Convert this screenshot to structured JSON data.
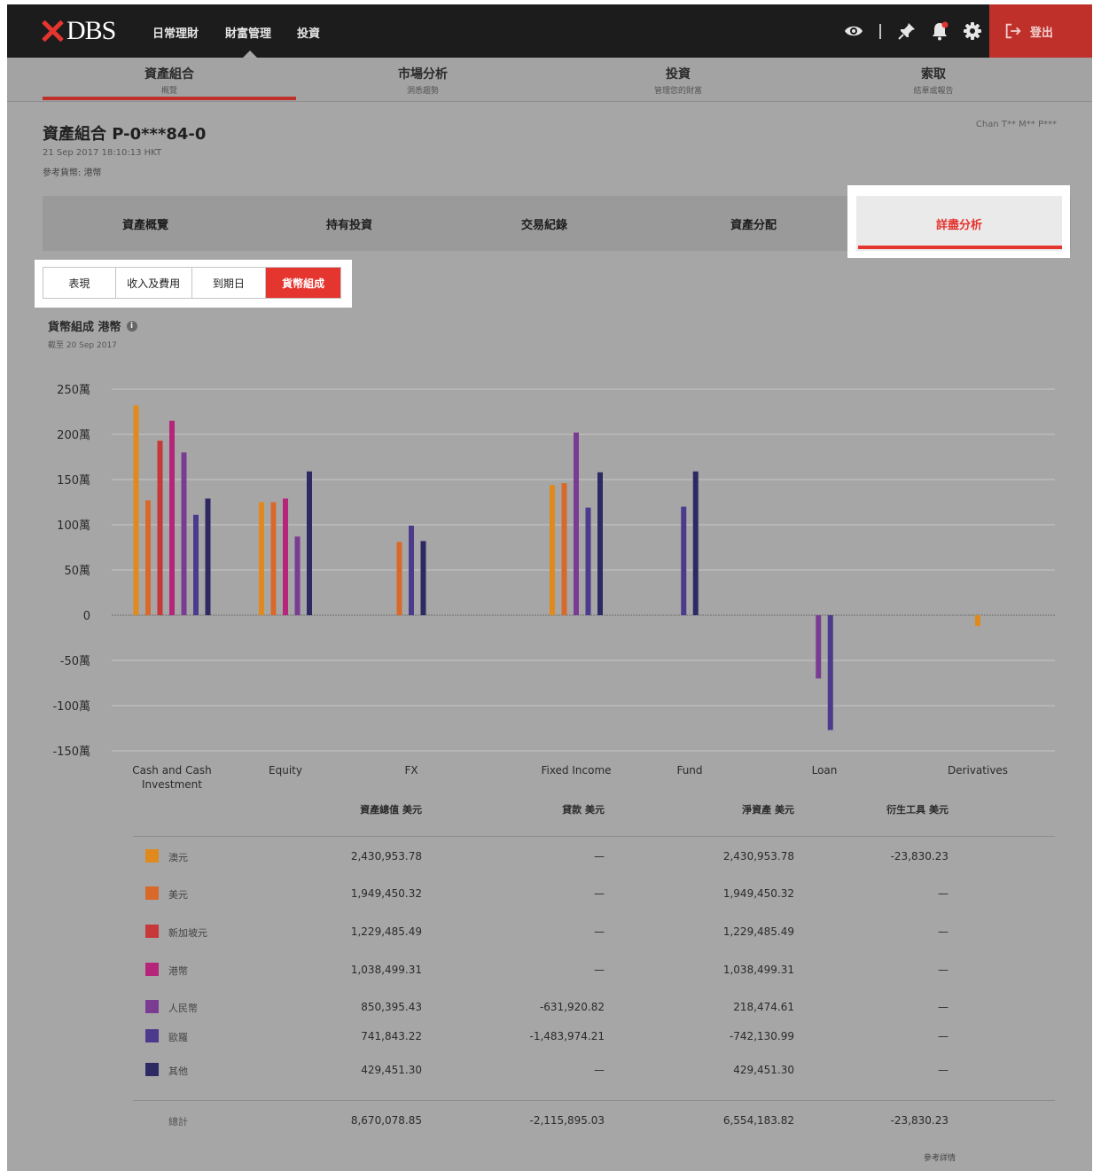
{
  "app": {
    "logo_text": "DBS",
    "top_nav": [
      "日常理財",
      "財富管理",
      "投資"
    ],
    "logout_label": "登出"
  },
  "subnav": [
    {
      "title": "資產組合",
      "subtitle": "概覽"
    },
    {
      "title": "市場分析",
      "subtitle": "洞悉趨勢"
    },
    {
      "title": "投資",
      "subtitle": "管理您的財富"
    },
    {
      "title": "索取",
      "subtitle": "結單或報告"
    }
  ],
  "header": {
    "portfolio_title": "資產組合 P-0***84-0",
    "date": "21 Sep 2017 18:10:13 HKT",
    "ref_currency": "參考貨幣: 港幣",
    "user": "Chan T** M** P***"
  },
  "section_tabs": [
    "資產概覽",
    "持有投資",
    "交易紀錄",
    "資產分配",
    "詳盡分析"
  ],
  "sub_tabs": [
    "表現",
    "收入及費用",
    "到期日",
    "貨幣組成"
  ],
  "chart": {
    "title": "貨幣組成 港幣",
    "as_of": "截至 20 Sep 2017",
    "y_tick_labels": [
      "250萬",
      "200萬",
      "150萬",
      "100萬",
      "50萬",
      "0",
      "-50萬",
      "-100萬",
      "-150萬"
    ]
  },
  "colors": {
    "usd_hkd_orange": "#e08a1e",
    "usd_orange": "#d9692a",
    "sgd_red": "#c7383a",
    "hkd_magenta": "#b5267a",
    "cny_purple": "#7a3c93",
    "eur_violet": "#4c3a8c",
    "other_navy": "#2d2a63",
    "accent": "#e5352f"
  },
  "chart_data": {
    "type": "bar",
    "categories": [
      "Cash and Cash Investment",
      "Equity",
      "FX",
      "Fixed Income",
      "Fund",
      "Loan",
      "Derivatives"
    ],
    "ylim": [
      -1500000,
      2500000
    ],
    "series": [
      {
        "name": "澳元",
        "color": "#e08a1e",
        "values": [
          2320000,
          1250000,
          0,
          1440000,
          0,
          0,
          -120000
        ]
      },
      {
        "name": "美元",
        "color": "#d9692a",
        "values": [
          1270000,
          1250000,
          810000,
          1460000,
          0,
          0,
          0
        ]
      },
      {
        "name": "新加坡元",
        "color": "#c7383a",
        "values": [
          1930000,
          0,
          0,
          0,
          0,
          0,
          0
        ]
      },
      {
        "name": "港幣",
        "color": "#b5267a",
        "values": [
          2150000,
          1290000,
          0,
          0,
          0,
          0,
          0
        ]
      },
      {
        "name": "人民幣",
        "color": "#7a3c93",
        "values": [
          1800000,
          870000,
          0,
          2020000,
          0,
          -700000,
          0
        ]
      },
      {
        "name": "歐羅",
        "color": "#4c3a8c",
        "values": [
          1110000,
          0,
          990000,
          1190000,
          1200000,
          -1270000,
          0
        ]
      },
      {
        "name": "其他",
        "color": "#2d2a63",
        "values": [
          1290000,
          1590000,
          820000,
          1580000,
          1590000,
          0,
          0
        ]
      }
    ]
  },
  "table": {
    "headers": [
      "資產總值 美元",
      "貸款 美元",
      "淨資產 美元",
      "衍生工具 美元"
    ],
    "rows": [
      {
        "name": "澳元",
        "color": "#e08a1e",
        "values": [
          "2,430,953.78",
          "—",
          "2,430,953.78",
          "-23,830.23"
        ]
      },
      {
        "name": "美元",
        "color": "#d9692a",
        "values": [
          "1,949,450.32",
          "—",
          "1,949,450.32",
          "—"
        ]
      },
      {
        "name": "新加坡元",
        "color": "#c7383a",
        "values": [
          "1,229,485.49",
          "—",
          "1,229,485.49",
          "—"
        ]
      },
      {
        "name": "港幣",
        "color": "#b5267a",
        "values": [
          "1,038,499.31",
          "—",
          "1,038,499.31",
          "—"
        ]
      },
      {
        "name": "人民幣",
        "color": "#7a3c93",
        "values": [
          "850,395.43",
          "-631,920.82",
          "218,474.61",
          "—"
        ]
      },
      {
        "name": "歐羅",
        "color": "#4c3a8c",
        "values": [
          "741,843.22",
          "-1,483,974.21",
          "-742,130.99",
          "—"
        ]
      },
      {
        "name": "其他",
        "color": "#2d2a63",
        "values": [
          "429,451.30",
          "—",
          "429,451.30",
          "—"
        ]
      }
    ],
    "total": {
      "name": "總計",
      "values": [
        "8,670,078.85",
        "-2,115,895.03",
        "6,554,183.82",
        "-23,830.23"
      ]
    },
    "footnote": "參考詳情"
  }
}
